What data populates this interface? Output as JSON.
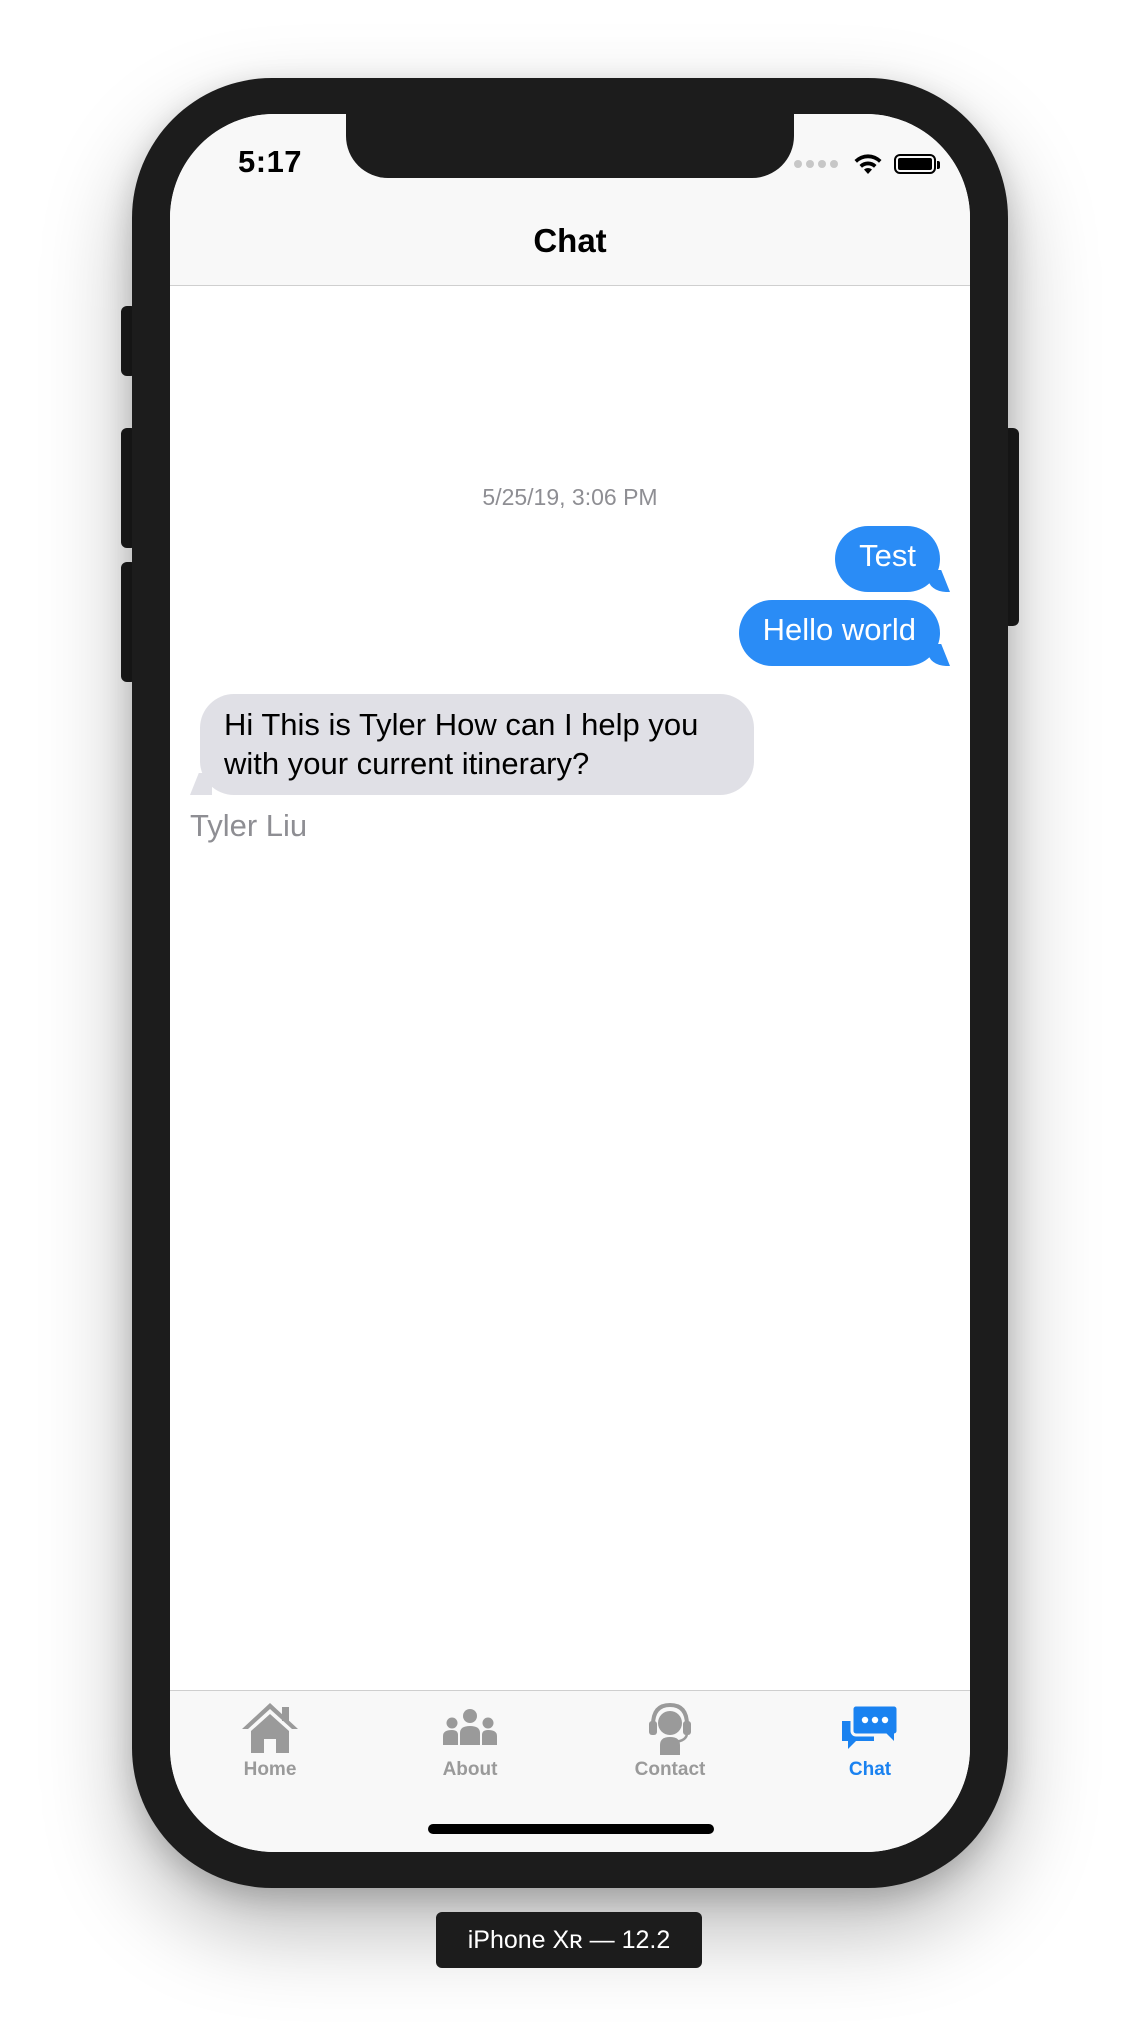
{
  "status_bar": {
    "time": "5:17"
  },
  "nav": {
    "title": "Chat"
  },
  "chat": {
    "timestamp": "5/25/19, 3:06 PM",
    "messages": [
      {
        "direction": "outgoing",
        "text": "Test"
      },
      {
        "direction": "outgoing",
        "text": "Hello world"
      },
      {
        "direction": "incoming",
        "text": "Hi This is Tyler How can I help you with your current itinerary?",
        "sender": "Tyler Liu"
      }
    ]
  },
  "tabs": [
    {
      "label": "Home",
      "icon": "house-icon",
      "active": false
    },
    {
      "label": "About",
      "icon": "people-group-icon",
      "active": false
    },
    {
      "label": "Contact",
      "icon": "headset-support-icon",
      "active": false
    },
    {
      "label": "Chat",
      "icon": "chat-bubbles-icon",
      "active": true
    }
  ],
  "device_label": "iPhone Xʀ — 12.2",
  "colors": {
    "outgoing_bubble": "#2a8cf6",
    "incoming_bubble": "#e0e0e6",
    "tab_active": "#1a82f0",
    "tab_inactive": "#9a9a9a"
  }
}
